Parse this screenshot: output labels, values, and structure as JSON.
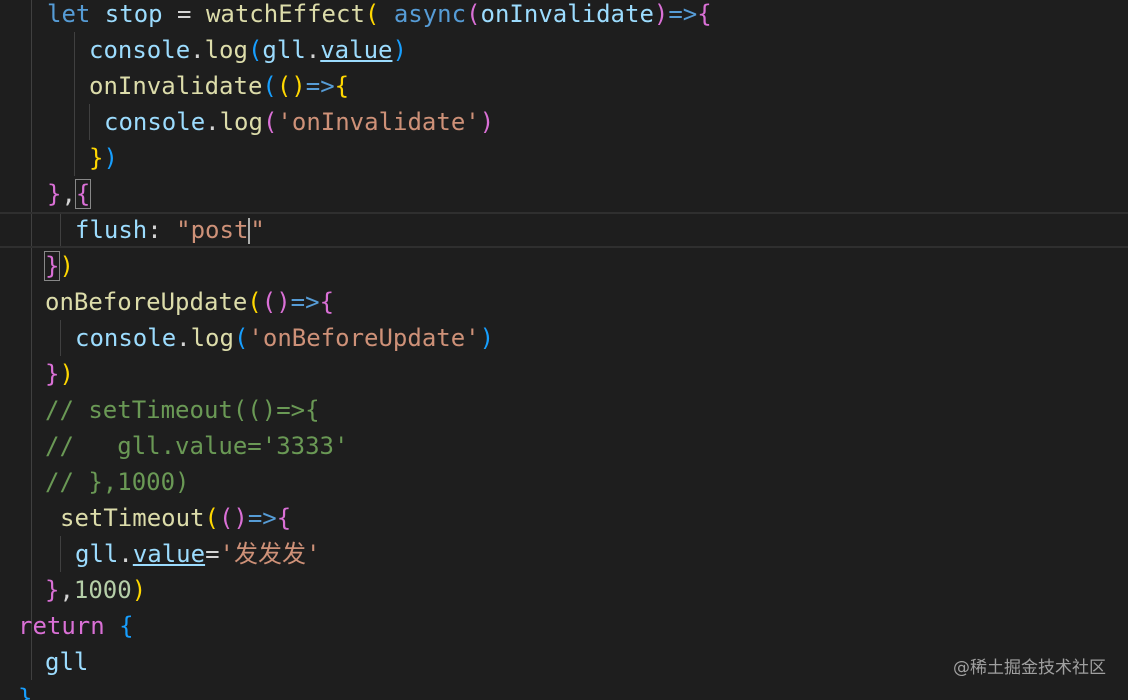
{
  "lines": [
    {
      "tokens": [
        {
          "t": "let ",
          "c": "kw"
        },
        {
          "t": "stop",
          "c": "var"
        },
        {
          "t": " = ",
          "c": "plain"
        },
        {
          "t": "watchEffect",
          "c": "fn"
        },
        {
          "t": "(",
          "c": "b1"
        },
        {
          "t": " ",
          "c": "plain"
        },
        {
          "t": "async",
          "c": "kw"
        },
        {
          "t": "(",
          "c": "b2"
        },
        {
          "t": "onInvalidate",
          "c": "var"
        },
        {
          "t": ")",
          "c": "b2"
        },
        {
          "t": "=>",
          "c": "kw"
        },
        {
          "t": "{",
          "c": "b2"
        }
      ]
    },
    {
      "tokens": [
        {
          "t": "console",
          "c": "var"
        },
        {
          "t": ".",
          "c": "plain"
        },
        {
          "t": "log",
          "c": "fn"
        },
        {
          "t": "(",
          "c": "b3"
        },
        {
          "t": "gll",
          "c": "var"
        },
        {
          "t": ".",
          "c": "plain"
        },
        {
          "t": "value",
          "c": "var",
          "u": true
        },
        {
          "t": ")",
          "c": "b3"
        }
      ]
    },
    {
      "tokens": [
        {
          "t": "onInvalidate",
          "c": "fn"
        },
        {
          "t": "(",
          "c": "b3"
        },
        {
          "t": "()",
          "c": "b1"
        },
        {
          "t": "=>",
          "c": "kw"
        },
        {
          "t": "{",
          "c": "b1"
        }
      ]
    },
    {
      "tokens": [
        {
          "t": "console",
          "c": "var"
        },
        {
          "t": ".",
          "c": "plain"
        },
        {
          "t": "log",
          "c": "fn"
        },
        {
          "t": "(",
          "c": "b2"
        },
        {
          "t": "'onInvalidate'",
          "c": "str"
        },
        {
          "t": ")",
          "c": "b2"
        }
      ]
    },
    {
      "tokens": [
        {
          "t": "}",
          "c": "b1"
        },
        {
          "t": ")",
          "c": "b3"
        }
      ]
    },
    {
      "tokens": [
        {
          "t": "}",
          "c": "b2"
        },
        {
          "t": ",",
          "c": "plain"
        },
        {
          "t": "{",
          "c": "b2",
          "m": true
        }
      ]
    },
    {
      "current": true,
      "tokens": [
        {
          "t": "flush",
          "c": "var"
        },
        {
          "t": ": ",
          "c": "plain"
        },
        {
          "t": "\"post",
          "c": "str"
        },
        {
          "cursor": true
        },
        {
          "t": "\"",
          "c": "str"
        }
      ]
    },
    {
      "tokens": [
        {
          "t": "}",
          "c": "b2",
          "m": true
        },
        {
          "t": ")",
          "c": "b1"
        }
      ]
    },
    {
      "tokens": [
        {
          "t": "onBeforeUpdate",
          "c": "fn"
        },
        {
          "t": "(",
          "c": "b1"
        },
        {
          "t": "()",
          "c": "b2"
        },
        {
          "t": "=>",
          "c": "kw"
        },
        {
          "t": "{",
          "c": "b2"
        }
      ]
    },
    {
      "tokens": [
        {
          "t": "console",
          "c": "var"
        },
        {
          "t": ".",
          "c": "plain"
        },
        {
          "t": "log",
          "c": "fn"
        },
        {
          "t": "(",
          "c": "b3"
        },
        {
          "t": "'onBeforeUpdate'",
          "c": "str"
        },
        {
          "t": ")",
          "c": "b3"
        }
      ]
    },
    {
      "tokens": [
        {
          "t": "}",
          "c": "b2"
        },
        {
          "t": ")",
          "c": "b1"
        }
      ]
    },
    {
      "tokens": [
        {
          "t": "// setTimeout(()=>{",
          "c": "cmt"
        }
      ]
    },
    {
      "tokens": [
        {
          "t": "//   gll.value='3333'",
          "c": "cmt"
        }
      ]
    },
    {
      "tokens": [
        {
          "t": "// },1000)",
          "c": "cmt"
        }
      ]
    },
    {
      "tokens": [
        {
          "t": "setTimeout",
          "c": "fn"
        },
        {
          "t": "(",
          "c": "b1"
        },
        {
          "t": "()",
          "c": "b2"
        },
        {
          "t": "=>",
          "c": "kw"
        },
        {
          "t": "{",
          "c": "b2"
        }
      ]
    },
    {
      "tokens": [
        {
          "t": "gll",
          "c": "var"
        },
        {
          "t": ".",
          "c": "plain"
        },
        {
          "t": "value",
          "c": "var",
          "u": true
        },
        {
          "t": "=",
          "c": "plain"
        },
        {
          "t": "'发发发'",
          "c": "str"
        }
      ]
    },
    {
      "tokens": [
        {
          "t": "}",
          "c": "b2"
        },
        {
          "t": ",",
          "c": "plain"
        },
        {
          "t": "1000",
          "c": "num"
        },
        {
          "t": ")",
          "c": "b1"
        }
      ]
    },
    {
      "tokens": [
        {
          "t": "return",
          "c": "b2"
        },
        {
          "t": " ",
          "c": "plain"
        },
        {
          "t": "{",
          "c": "b3"
        }
      ]
    },
    {
      "tokens": [
        {
          "t": "gll",
          "c": "var"
        }
      ]
    },
    {
      "tokens": [
        {
          "t": "}",
          "c": "b3"
        }
      ]
    }
  ],
  "watermark": "@稀土掘金技术社区",
  "colors": {
    "background": "#1e1e1e",
    "keyword": "#569cd6",
    "function": "#dcdcaa",
    "variable": "#9cdcfe",
    "string": "#ce9178",
    "comment": "#6a9955",
    "number": "#b5cea8",
    "bracket_gold": "#ffd700",
    "bracket_orchid": "#da70d6",
    "bracket_blue": "#179fff"
  }
}
